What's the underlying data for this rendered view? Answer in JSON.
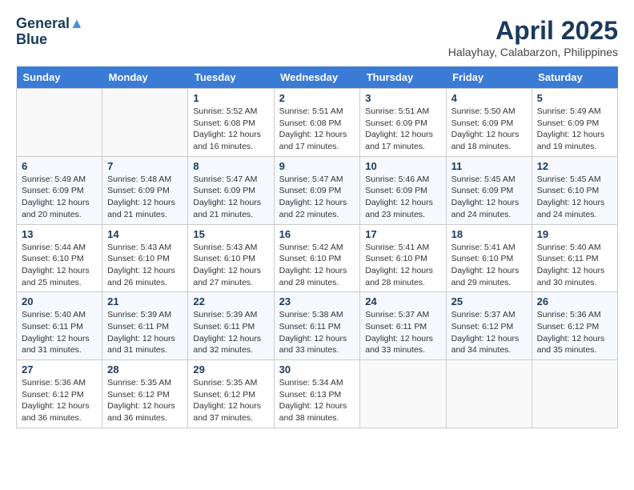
{
  "header": {
    "logo_line1": "General",
    "logo_line2": "Blue",
    "month": "April 2025",
    "location": "Halayhay, Calabarzon, Philippines"
  },
  "days_of_week": [
    "Sunday",
    "Monday",
    "Tuesday",
    "Wednesday",
    "Thursday",
    "Friday",
    "Saturday"
  ],
  "weeks": [
    [
      {
        "day": "",
        "detail": ""
      },
      {
        "day": "",
        "detail": ""
      },
      {
        "day": "1",
        "detail": "Sunrise: 5:52 AM\nSunset: 6:08 PM\nDaylight: 12 hours and 16 minutes."
      },
      {
        "day": "2",
        "detail": "Sunrise: 5:51 AM\nSunset: 6:08 PM\nDaylight: 12 hours and 17 minutes."
      },
      {
        "day": "3",
        "detail": "Sunrise: 5:51 AM\nSunset: 6:09 PM\nDaylight: 12 hours and 17 minutes."
      },
      {
        "day": "4",
        "detail": "Sunrise: 5:50 AM\nSunset: 6:09 PM\nDaylight: 12 hours and 18 minutes."
      },
      {
        "day": "5",
        "detail": "Sunrise: 5:49 AM\nSunset: 6:09 PM\nDaylight: 12 hours and 19 minutes."
      }
    ],
    [
      {
        "day": "6",
        "detail": "Sunrise: 5:49 AM\nSunset: 6:09 PM\nDaylight: 12 hours and 20 minutes."
      },
      {
        "day": "7",
        "detail": "Sunrise: 5:48 AM\nSunset: 6:09 PM\nDaylight: 12 hours and 21 minutes."
      },
      {
        "day": "8",
        "detail": "Sunrise: 5:47 AM\nSunset: 6:09 PM\nDaylight: 12 hours and 21 minutes."
      },
      {
        "day": "9",
        "detail": "Sunrise: 5:47 AM\nSunset: 6:09 PM\nDaylight: 12 hours and 22 minutes."
      },
      {
        "day": "10",
        "detail": "Sunrise: 5:46 AM\nSunset: 6:09 PM\nDaylight: 12 hours and 23 minutes."
      },
      {
        "day": "11",
        "detail": "Sunrise: 5:45 AM\nSunset: 6:09 PM\nDaylight: 12 hours and 24 minutes."
      },
      {
        "day": "12",
        "detail": "Sunrise: 5:45 AM\nSunset: 6:10 PM\nDaylight: 12 hours and 24 minutes."
      }
    ],
    [
      {
        "day": "13",
        "detail": "Sunrise: 5:44 AM\nSunset: 6:10 PM\nDaylight: 12 hours and 25 minutes."
      },
      {
        "day": "14",
        "detail": "Sunrise: 5:43 AM\nSunset: 6:10 PM\nDaylight: 12 hours and 26 minutes."
      },
      {
        "day": "15",
        "detail": "Sunrise: 5:43 AM\nSunset: 6:10 PM\nDaylight: 12 hours and 27 minutes."
      },
      {
        "day": "16",
        "detail": "Sunrise: 5:42 AM\nSunset: 6:10 PM\nDaylight: 12 hours and 28 minutes."
      },
      {
        "day": "17",
        "detail": "Sunrise: 5:41 AM\nSunset: 6:10 PM\nDaylight: 12 hours and 28 minutes."
      },
      {
        "day": "18",
        "detail": "Sunrise: 5:41 AM\nSunset: 6:10 PM\nDaylight: 12 hours and 29 minutes."
      },
      {
        "day": "19",
        "detail": "Sunrise: 5:40 AM\nSunset: 6:11 PM\nDaylight: 12 hours and 30 minutes."
      }
    ],
    [
      {
        "day": "20",
        "detail": "Sunrise: 5:40 AM\nSunset: 6:11 PM\nDaylight: 12 hours and 31 minutes."
      },
      {
        "day": "21",
        "detail": "Sunrise: 5:39 AM\nSunset: 6:11 PM\nDaylight: 12 hours and 31 minutes."
      },
      {
        "day": "22",
        "detail": "Sunrise: 5:39 AM\nSunset: 6:11 PM\nDaylight: 12 hours and 32 minutes."
      },
      {
        "day": "23",
        "detail": "Sunrise: 5:38 AM\nSunset: 6:11 PM\nDaylight: 12 hours and 33 minutes."
      },
      {
        "day": "24",
        "detail": "Sunrise: 5:37 AM\nSunset: 6:11 PM\nDaylight: 12 hours and 33 minutes."
      },
      {
        "day": "25",
        "detail": "Sunrise: 5:37 AM\nSunset: 6:12 PM\nDaylight: 12 hours and 34 minutes."
      },
      {
        "day": "26",
        "detail": "Sunrise: 5:36 AM\nSunset: 6:12 PM\nDaylight: 12 hours and 35 minutes."
      }
    ],
    [
      {
        "day": "27",
        "detail": "Sunrise: 5:36 AM\nSunset: 6:12 PM\nDaylight: 12 hours and 36 minutes."
      },
      {
        "day": "28",
        "detail": "Sunrise: 5:35 AM\nSunset: 6:12 PM\nDaylight: 12 hours and 36 minutes."
      },
      {
        "day": "29",
        "detail": "Sunrise: 5:35 AM\nSunset: 6:12 PM\nDaylight: 12 hours and 37 minutes."
      },
      {
        "day": "30",
        "detail": "Sunrise: 5:34 AM\nSunset: 6:13 PM\nDaylight: 12 hours and 38 minutes."
      },
      {
        "day": "",
        "detail": ""
      },
      {
        "day": "",
        "detail": ""
      },
      {
        "day": "",
        "detail": ""
      }
    ]
  ]
}
